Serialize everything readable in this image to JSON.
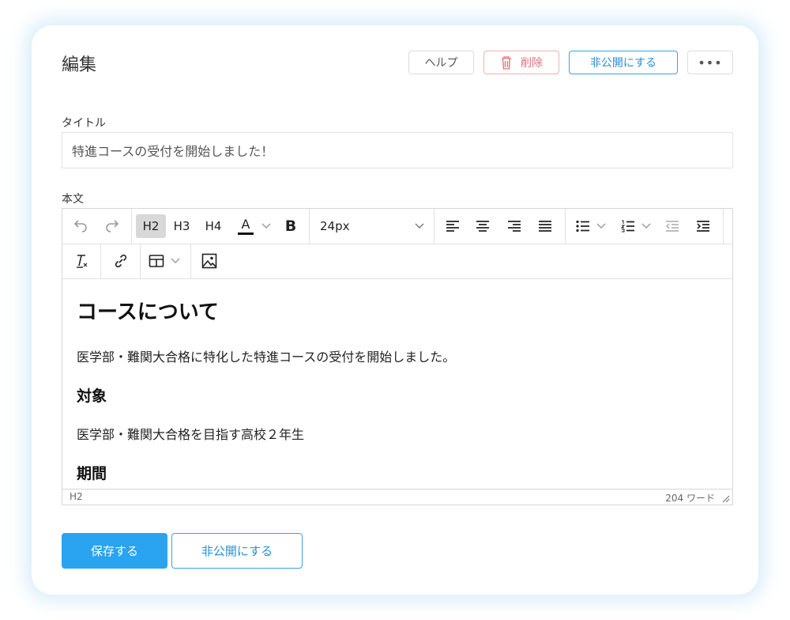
{
  "page": {
    "title": "編集"
  },
  "header": {
    "help_label": "ヘルプ",
    "delete_label": "削除",
    "unpublish_label": "非公開にする",
    "more_label": "•••"
  },
  "form": {
    "title_label": "タイトル",
    "title_value": "特進コースの受付を開始しました！",
    "body_label": "本文"
  },
  "toolbar": {
    "h2": "H2",
    "h3": "H3",
    "h4": "H4",
    "bold": "B",
    "font_size": "24px",
    "color_letter": "A"
  },
  "content": {
    "heading": "コースについて",
    "para1": "医学部・難関大合格に特化した特進コースの受付を開始しました。",
    "sub1": "対象",
    "para2": "医学部・難関大合格を目指す高校２年生",
    "sub2": "期間"
  },
  "status": {
    "path": "H2",
    "word_count": "204 ワード"
  },
  "footer": {
    "save_label": "保存する",
    "unpublish_label": "非公開にする"
  },
  "colors": {
    "accent": "#2aa3f0",
    "danger": "#e0707a"
  }
}
